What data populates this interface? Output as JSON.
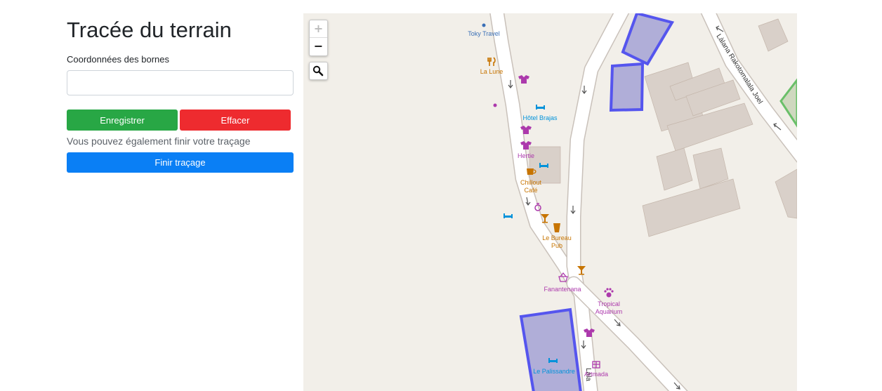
{
  "form": {
    "title": "Tracée du terrain",
    "coords_label": "Coordonnées des bornes",
    "coords_value": "",
    "save_label": "Enregistrer",
    "clear_label": "Effacer",
    "hint": "Vous pouvez également finir votre traçage",
    "finish_label": "Finir traçage"
  },
  "map": {
    "zoom_in": "+",
    "zoom_out": "−",
    "search_icon": "magnifier-icon",
    "streets": {
      "rakotomalala": "Làlana Rakotomalala Joel",
      "lala_south": "Làla"
    },
    "pois": {
      "toky_travel": "Toky Travel",
      "la_lune": "La Lune",
      "hotel_brajas": "Hôtel Brajas",
      "hertie": "Hertie",
      "chillout_1": "Chillout",
      "chillout_2": "Café",
      "bureau_1": "Le Bureau",
      "bureau_2": "Pub",
      "fanantenana": "Fanantenana",
      "tropical_1": "Tropical",
      "tropical_2": "Aquarium",
      "palissandre": "Le Palissandre",
      "artmada": "Artmada"
    },
    "colors": {
      "land": "#f2efe9",
      "building": "#d9d0c9",
      "road": "#ffffff",
      "selection": "#5555ee",
      "food": "#c77400",
      "shop": "#ac39ac",
      "hotel": "#0092da"
    }
  }
}
